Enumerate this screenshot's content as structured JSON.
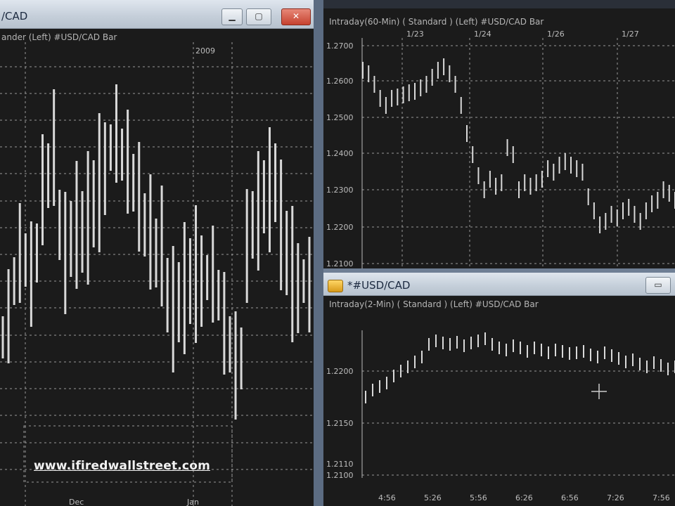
{
  "left_window": {
    "title": "/CAD",
    "subheader": "ander  (Left)  #USD/CAD  Bar",
    "year_label": "2009",
    "x_labels": [
      "Dec",
      "Jan"
    ],
    "controls": [
      "minimize",
      "maximize",
      "close"
    ]
  },
  "top_right_window": {
    "subheader": "Intraday(60-Min)  ( Standard )  (Left)  #USD/CAD  Bar",
    "x_labels": [
      "1/23",
      "1/24",
      "1/26",
      "1/27"
    ],
    "y_labels": [
      "1.2700",
      "1.2600",
      "1.2500",
      "1.2400",
      "1.2300",
      "1.2200",
      "1.2100"
    ]
  },
  "bottom_right_window": {
    "title": "*#USD/CAD",
    "subheader": "Intraday(2-Min)  ( Standard )  (Left)  #USD/CAD  Bar",
    "y_labels": [
      "1.2200",
      "1.2150",
      "1.2110",
      "1.2100"
    ],
    "x_labels": [
      "4:56",
      "5:26",
      "5:56",
      "6:26",
      "6:56",
      "7:26",
      "7:56"
    ]
  },
  "watermark": "www.ifiredwallstreet.com",
  "colors": {
    "chart_bg": "#1b1b1b",
    "price_bars": "#d9d9d9",
    "grid": "#9a9a9a",
    "title_bar": "#c9d3de",
    "close_btn": "#d0533e"
  }
}
